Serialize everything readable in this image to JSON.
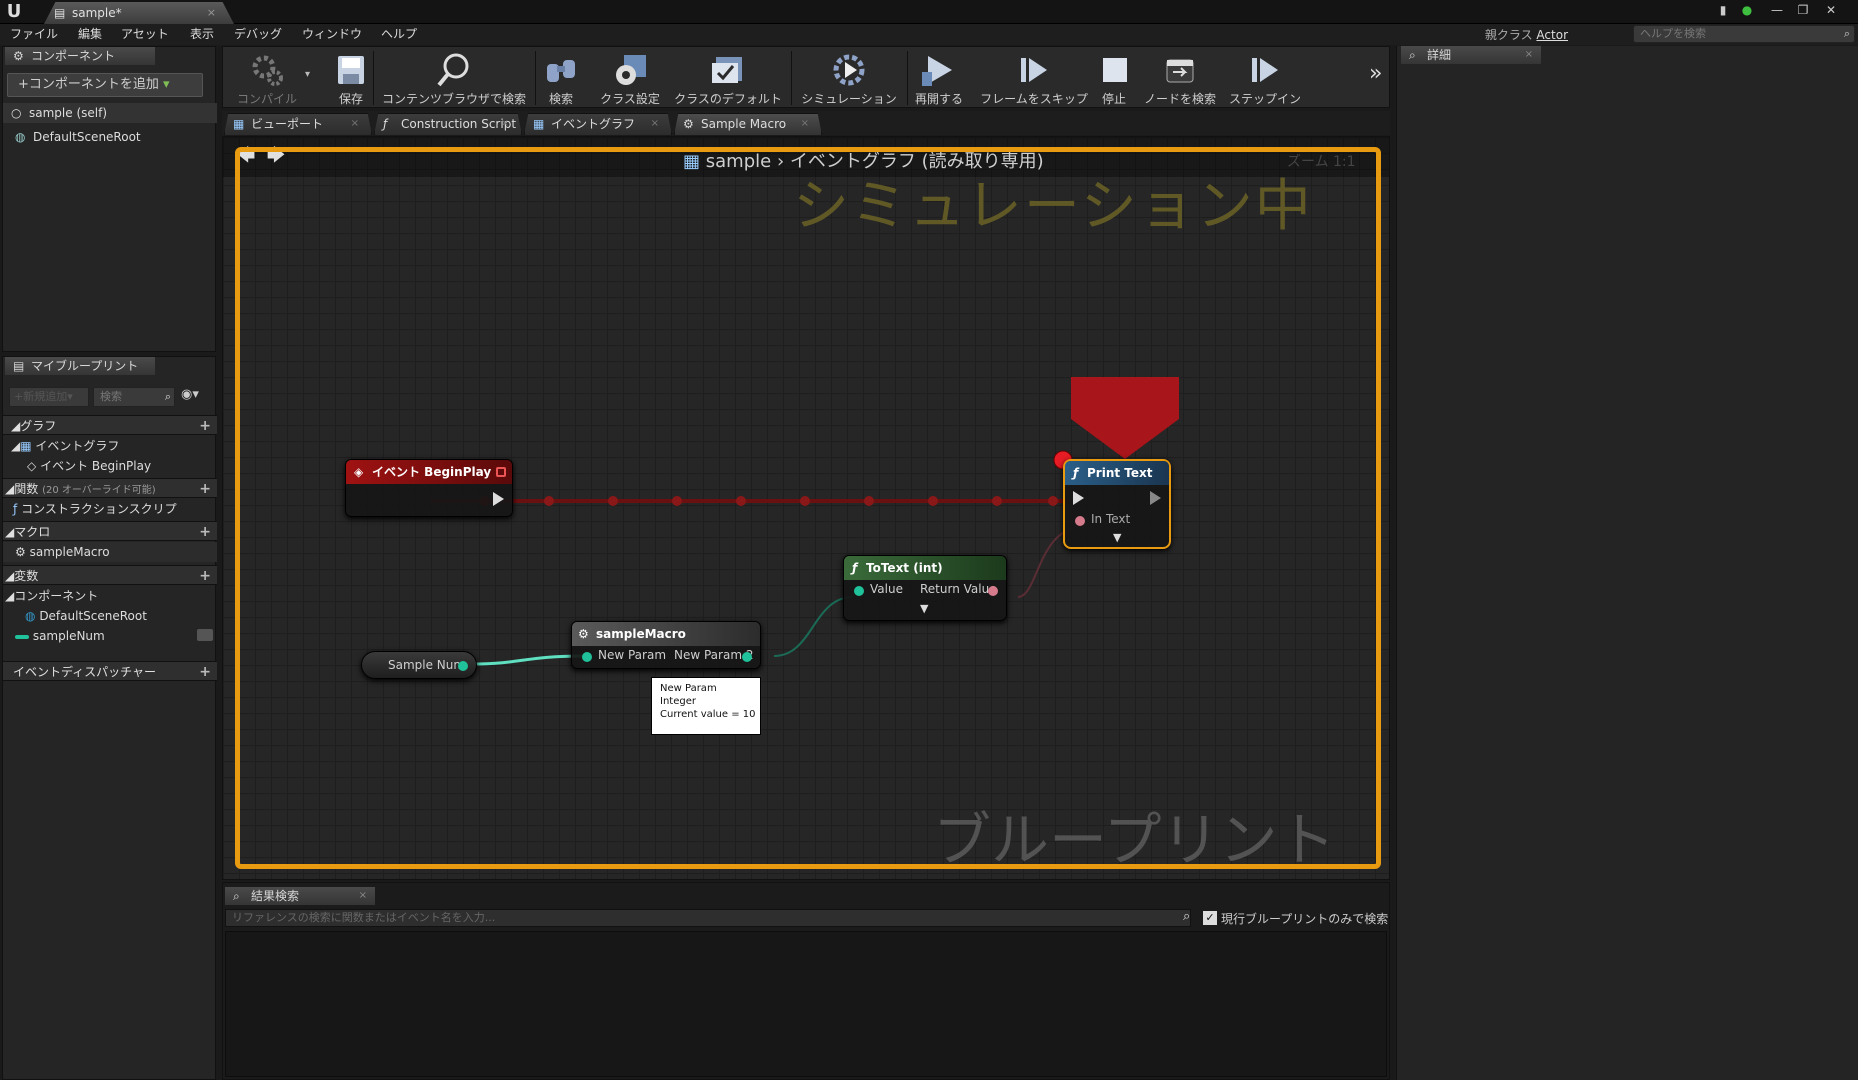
{
  "window": {
    "tab_title": "sample*",
    "parent_class_label": "親クラス",
    "parent_class_value": "Actor",
    "help_search_placeholder": "ヘルプを検索"
  },
  "menu": [
    "ファイル",
    "編集",
    "アセット",
    "表示",
    "デバッグ",
    "ウィンドウ",
    "ヘルプ"
  ],
  "components_panel": {
    "tab": "コンポーネント",
    "add_button": "+コンポーネントを追加",
    "items": [
      "sample (self)",
      "DefaultSceneRoot"
    ]
  },
  "my_blueprint": {
    "tab": "マイブループリント",
    "add_new": "+新規追加",
    "search_placeholder": "検索",
    "graphs": {
      "label": "グラフ",
      "event_graph": "イベントグラフ",
      "begin_play": "イベント BeginPlay"
    },
    "functions": {
      "label": "関数",
      "note": "(20 オーバーライド可能)",
      "construction": "コンストラクションスクリプ"
    },
    "macros": {
      "label": "マクロ",
      "item": "sampleMacro"
    },
    "variables": {
      "label": "変数",
      "components": "コンポーネント",
      "root": "DefaultSceneRoot",
      "var": "sampleNum"
    },
    "dispatchers": "イベントディスパッチャー"
  },
  "toolbar": {
    "compile": "コンパイル",
    "save": "保存",
    "browse": "コンテンツブラウザで検索",
    "search": "検索",
    "class_settings": "クラス設定",
    "class_defaults": "クラスのデフォルト",
    "simulation": "シミュレーション",
    "resume": "再開する",
    "skip_frame": "フレームをスキップ",
    "stop": "停止",
    "find_node": "ノードを検索",
    "step_in": "ステップイン"
  },
  "graph_tabs": [
    "ビューポート",
    "Construction Script",
    "イベントグラフ",
    "Sample Macro"
  ],
  "graph": {
    "breadcrumb_root": "sample",
    "breadcrumb_graph": "イベントグラフ",
    "read_only": "(読み取り専用)",
    "zoom_hint": "ズーム 1:1",
    "simulating": "シミュレーション中",
    "watermark": "ブループリント",
    "nodes": {
      "begin_play": {
        "title": "イベント BeginPlay"
      },
      "print_text": {
        "title": "Print Text",
        "pin_in_text": "In Text"
      },
      "to_text": {
        "title": "ToText (int)",
        "pin_value": "Value",
        "pin_return": "Return Value"
      },
      "macro": {
        "title": "sampleMacro",
        "pin_in": "New Param",
        "pin_out": "New Param 2"
      },
      "var_get": {
        "title": "Sample Num"
      }
    },
    "tooltip": [
      "New Param",
      "Integer",
      "Current value = 10"
    ]
  },
  "results": {
    "tab": "結果検索",
    "placeholder": "リファレンスの検索に関数またはイベント名を入力...",
    "checkbox_label": "現行ブループリントのみで検索",
    "checkbox_checked": true
  },
  "details": {
    "tab": "詳細"
  },
  "colors": {
    "sim_border": "#e89a10",
    "event_header": "#8a1010",
    "function_header": "#1f4a6a",
    "pure_header": "#2b5a2b",
    "int_pin": "#1fc29a",
    "text_pin": "#d67b8c"
  }
}
